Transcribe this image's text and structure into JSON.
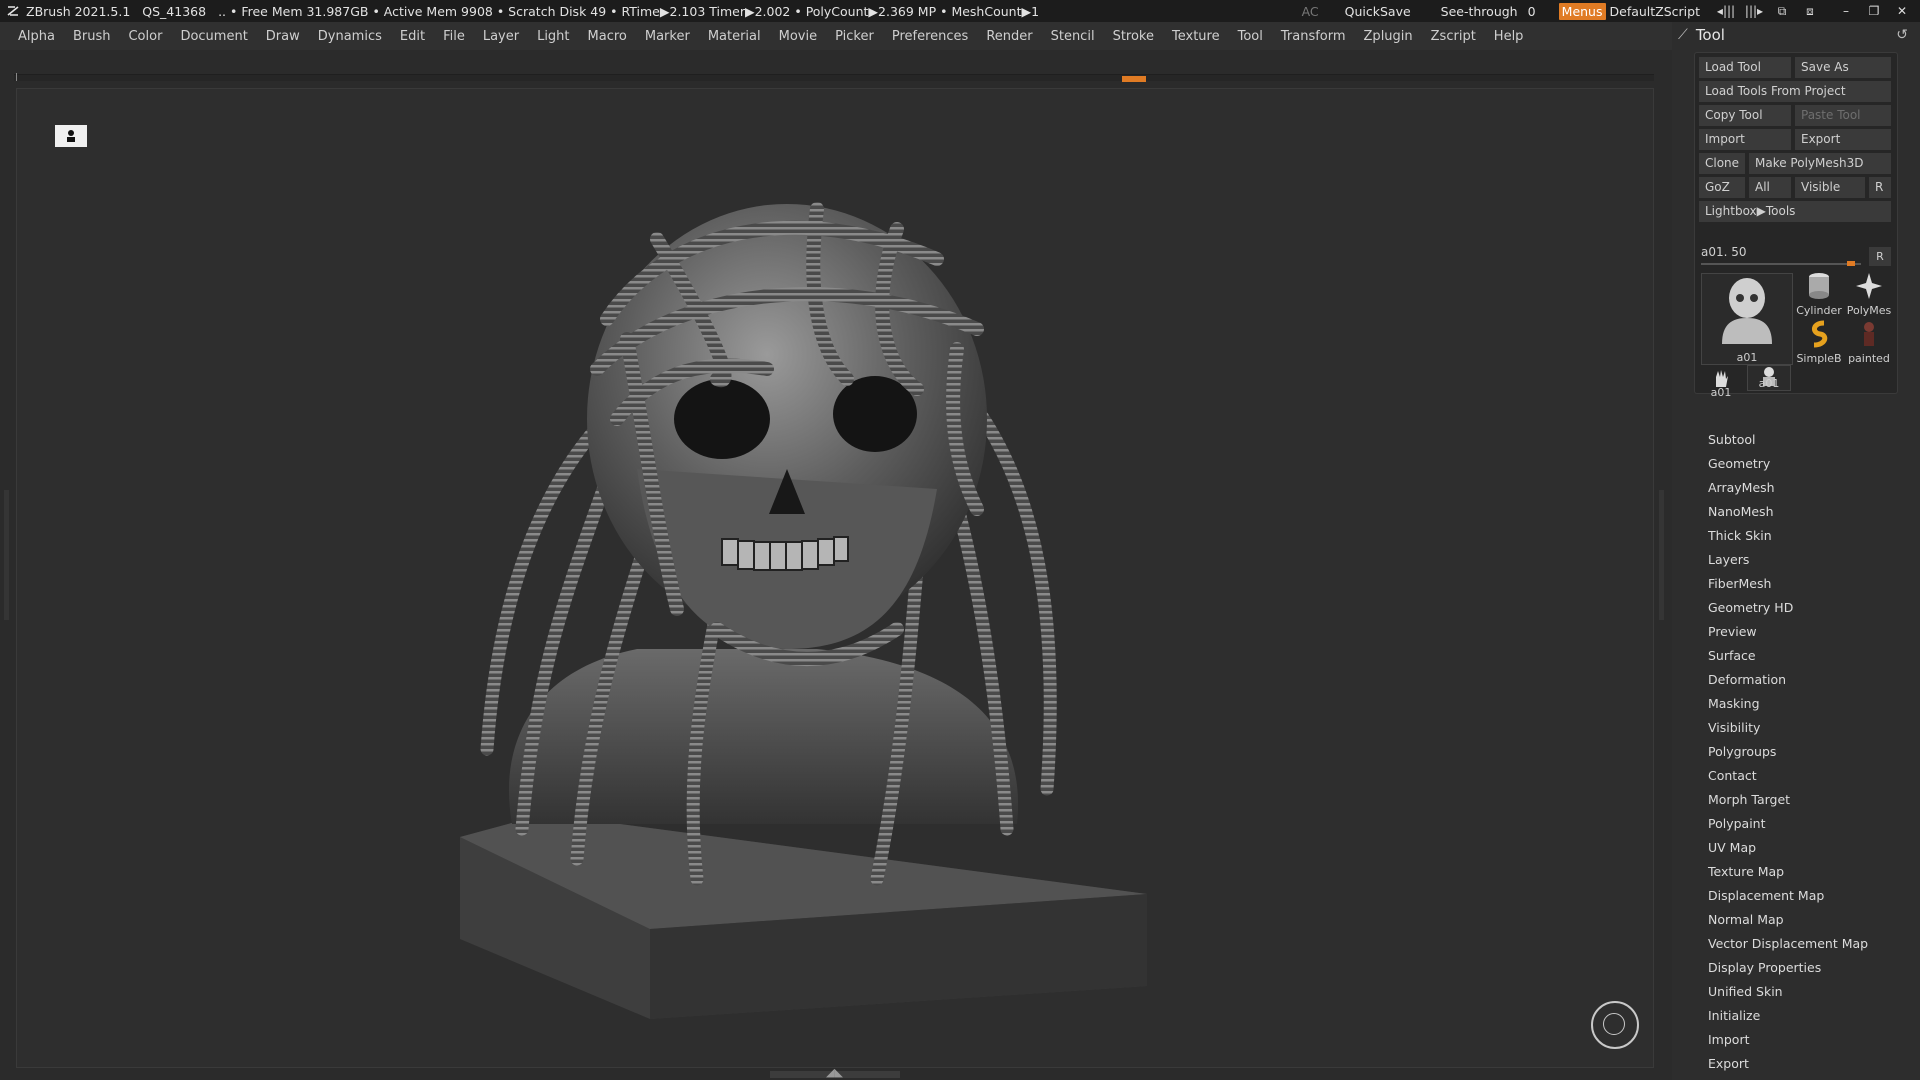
{
  "titlebar": {
    "app": "ZBrush 2021.5.1",
    "qs": "QS_41368",
    "status": ".. • Free Mem 31.987GB • Active Mem 9908 • Scratch Disk 49 • RTime▶2.103 Timer▶2.002 • PolyCount▶2.369 MP • MeshCount▶1",
    "ac": "AC",
    "quicksave": "QuickSave",
    "seethrough_label": "See-through",
    "seethrough_value": "0",
    "seethrough_fraction": 0.1,
    "menus": "Menus",
    "script": "DefaultZScript"
  },
  "menubar": {
    "items": [
      "Alpha",
      "Brush",
      "Color",
      "Document",
      "Draw",
      "Dynamics",
      "Edit",
      "File",
      "Layer",
      "Light",
      "Macro",
      "Marker",
      "Material",
      "Movie",
      "Picker",
      "Preferences",
      "Render",
      "Stencil",
      "Stroke",
      "Texture",
      "Tool",
      "Transform",
      "Zplugin",
      "Zscript",
      "Help"
    ]
  },
  "tool_panel": {
    "title": "Tool",
    "buttons": {
      "load_tool": "Load Tool",
      "save_as": "Save As",
      "load_from_project": "Load Tools From Project",
      "copy_tool": "Copy Tool",
      "paste_tool": "Paste Tool",
      "import": "Import",
      "export": "Export",
      "clone": "Clone",
      "make_polymesh": "Make PolyMesh3D",
      "goz": "GoZ",
      "all": "All",
      "visible": "Visible",
      "r": "R",
      "lightbox": "Lightbox▶Tools"
    },
    "slider_label": "a01. 50",
    "slider_fraction": 0.94,
    "thumbs": {
      "main": "a01",
      "cylinder": "Cylinder",
      "polymesh": "PolyMes",
      "simpleb": "SimpleB",
      "painted": "painted",
      "hand": "a01",
      "bust": "a01"
    },
    "subpalettes": [
      "Subtool",
      "Geometry",
      "ArrayMesh",
      "NanoMesh",
      "Thick Skin",
      "Layers",
      "FiberMesh",
      "Geometry HD",
      "Preview",
      "Surface",
      "Deformation",
      "Masking",
      "Visibility",
      "Polygroups",
      "Contact",
      "Morph Target",
      "Polypaint",
      "UV Map",
      "Texture Map",
      "Displacement Map",
      "Normal Map",
      "Vector Displacement Map",
      "Display Properties",
      "Unified Skin",
      "Initialize",
      "Import",
      "Export"
    ]
  }
}
